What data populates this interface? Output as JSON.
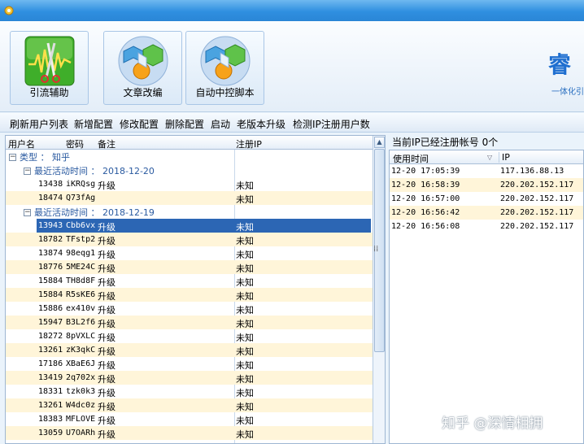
{
  "ribbon": {
    "buttons": [
      {
        "label": "引流辅助",
        "icon": "waveform-scissors-icon"
      },
      {
        "label": "文章改编",
        "icon": "cubes-icon"
      },
      {
        "label": "自动中控脚本",
        "icon": "cubes-icon"
      }
    ],
    "brand": "睿",
    "brand_sub": "一体化引"
  },
  "menu": [
    "刷新用户列表",
    "新增配置",
    "修改配置",
    "删除配置",
    "启动",
    "老版本升级",
    "检测IP注册用户数"
  ],
  "left_grid": {
    "headers": [
      "用户名",
      "密码",
      "备注",
      "注册IP"
    ],
    "group_type": "类型 ： 知乎",
    "group_date1": "最近活动时间 ： 2018-12-20",
    "rows_date1": [
      {
        "id": "13438",
        "pw": "iKRQsg",
        "note": "升级",
        "ip": "未知"
      },
      {
        "id": "18474",
        "pw": "Q73fAg",
        "note": "",
        "ip": "未知"
      }
    ],
    "group_date2": "最近活动时间 ： 2018-12-19",
    "rows_date2": [
      {
        "id": "13943",
        "pw": "Cbb6vx",
        "note": "升级",
        "ip": "未知"
      },
      {
        "id": "18782",
        "pw": "TFstp2",
        "note": "升级",
        "ip": "未知"
      },
      {
        "id": "13874",
        "pw": "98eqg1",
        "note": "升级",
        "ip": "未知"
      },
      {
        "id": "18776",
        "pw": "5ME24C",
        "note": "升级",
        "ip": "未知"
      },
      {
        "id": "15884",
        "pw": "TH8d8F",
        "note": "升级",
        "ip": "未知"
      },
      {
        "id": "15884",
        "pw": "R5sKE6",
        "note": "升级",
        "ip": "未知"
      },
      {
        "id": "15886",
        "pw": "ex410v",
        "note": "升级",
        "ip": "未知"
      },
      {
        "id": "15947",
        "pw": "B3L2f6",
        "note": "升级",
        "ip": "未知"
      },
      {
        "id": "18272",
        "pw": "8pVXLC",
        "note": "升级",
        "ip": "未知"
      },
      {
        "id": "13261",
        "pw": "zK3qkC",
        "note": "升级",
        "ip": "未知"
      },
      {
        "id": "17186",
        "pw": "XBaE6J",
        "note": "升级",
        "ip": "未知"
      },
      {
        "id": "13419",
        "pw": "2q702x",
        "note": "升级",
        "ip": "未知"
      },
      {
        "id": "18331",
        "pw": "tzk0k3",
        "note": "升级",
        "ip": "未知"
      },
      {
        "id": "13261",
        "pw": "W4dc0z",
        "note": "升级",
        "ip": "未知"
      },
      {
        "id": "18383",
        "pw": "MFLOVE",
        "note": "升级",
        "ip": "未知"
      },
      {
        "id": "13059",
        "pw": "U7OARh",
        "note": "升级",
        "ip": "未知"
      }
    ]
  },
  "right_panel": {
    "title": "当前IP已经注册帐号 0个",
    "headers": [
      "使用时间",
      "IP"
    ],
    "rows": [
      {
        "time": "12-20 17:05:39",
        "ip": "117.136.88.13"
      },
      {
        "time": "12-20 16:58:39",
        "ip": "220.202.152.117"
      },
      {
        "time": "12-20 16:57:00",
        "ip": "220.202.152.117"
      },
      {
        "time": "12-20 16:56:42",
        "ip": "220.202.152.117"
      },
      {
        "time": "12-20 16:56:08",
        "ip": "220.202.152.117"
      }
    ]
  },
  "watermark": "知乎 @深情相拥"
}
